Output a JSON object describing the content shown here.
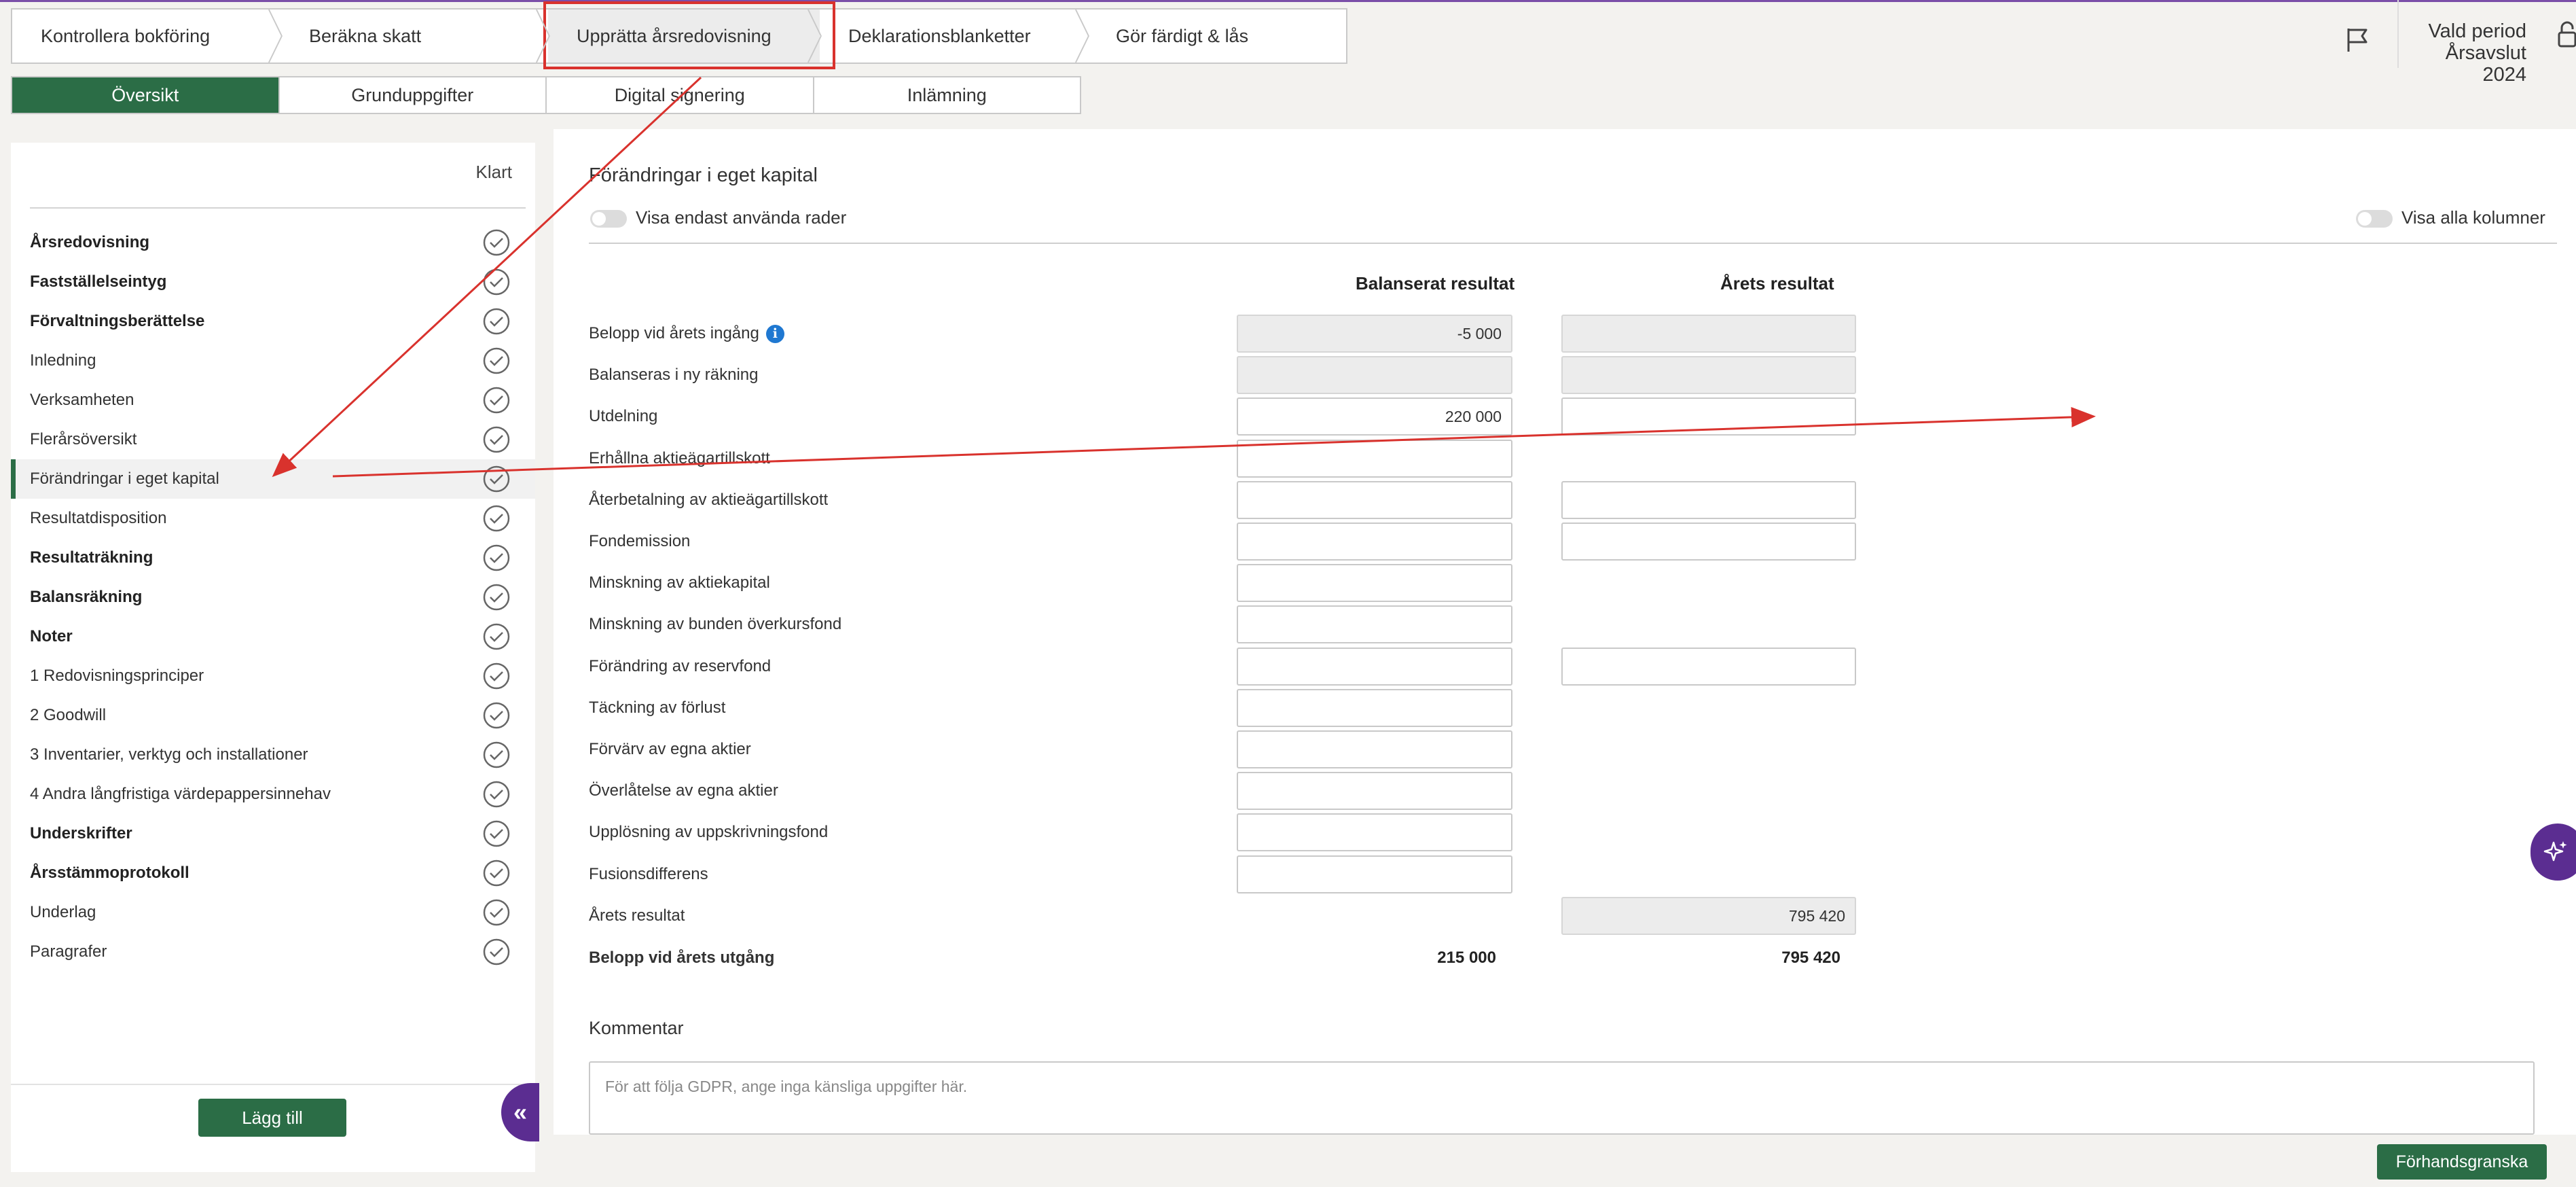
{
  "steps": [
    {
      "label": "Kontrollera bokföring"
    },
    {
      "label": "Beräkna skatt"
    },
    {
      "label": "Upprätta årsredovisning"
    },
    {
      "label": "Deklarationsblanketter"
    },
    {
      "label": "Gör färdigt & lås"
    }
  ],
  "header": {
    "period_label": "Vald period",
    "period_value": "Årsavslut 2024",
    "flag_icon": "flag-icon",
    "lock_icon": "lock-icon"
  },
  "tabs": [
    {
      "label": "Översikt"
    },
    {
      "label": "Grunduppgifter"
    },
    {
      "label": "Digital signering"
    },
    {
      "label": "Inlämning"
    }
  ],
  "sidebar": {
    "header": "Klart",
    "items": [
      {
        "label": "Årsredovisning"
      },
      {
        "label": "Fastställelseintyg"
      },
      {
        "label": "Förvaltningsberättelse"
      },
      {
        "label": "Inledning"
      },
      {
        "label": "Verksamheten"
      },
      {
        "label": "Flerårsöversikt"
      },
      {
        "label": "Förändringar i eget kapital"
      },
      {
        "label": "Resultatdisposition"
      },
      {
        "label": "Resultaträkning"
      },
      {
        "label": "Balansräkning"
      },
      {
        "label": "Noter"
      },
      {
        "label": "1 Redovisningsprinciper"
      },
      {
        "label": "2 Goodwill"
      },
      {
        "label": "3 Inventarier, verktyg och installationer"
      },
      {
        "label": "4 Andra långfristiga värdepappersinnehav"
      },
      {
        "label": "Underskrifter"
      },
      {
        "label": "Årsstämmoprotokoll"
      },
      {
        "label": "Underlag"
      },
      {
        "label": "Paragrafer"
      }
    ],
    "add_button": "Lägg till",
    "collapse_icon": "«"
  },
  "main": {
    "title": "Förändringar i eget kapital",
    "toggle_used_rows": "Visa endast använda rader",
    "toggle_all_columns": "Visa alla kolumner",
    "columns": [
      "Balanserat resultat",
      "Årets resultat"
    ],
    "info_glyph": "i",
    "rows": [
      {
        "label": "Belopp vid årets ingång",
        "c1": "-5 000",
        "c2": ""
      },
      {
        "label": "Balanseras i ny räkning",
        "c1": "",
        "c2": ""
      },
      {
        "label": "Utdelning",
        "c1": "220 000",
        "c2": ""
      },
      {
        "label": "Erhållna aktieägartillskott",
        "c1": ""
      },
      {
        "label": "Återbetalning av aktieägartillskott",
        "c1": "",
        "c2": ""
      },
      {
        "label": "Fondemission",
        "c1": "",
        "c2": ""
      },
      {
        "label": "Minskning av aktiekapital",
        "c1": ""
      },
      {
        "label": "Minskning av bunden överkursfond",
        "c1": ""
      },
      {
        "label": "Förändring av reservfond",
        "c1": "",
        "c2": ""
      },
      {
        "label": "Täckning av förlust",
        "c1": ""
      },
      {
        "label": "Förvärv av egna aktier",
        "c1": ""
      },
      {
        "label": "Överlåtelse av egna aktier",
        "c1": ""
      },
      {
        "label": "Upplösning av uppskrivningsfond",
        "c1": ""
      },
      {
        "label": "Fusionsdifferens",
        "c1": ""
      },
      {
        "label": "Årets resultat",
        "c2": "795 420"
      }
    ],
    "total_label": "Belopp vid årets utgång",
    "total_c1": "215 000",
    "total_c2": "795 420",
    "comment_title": "Kommentar",
    "comment_placeholder": "För att följa GDPR, ange inga känsliga uppgifter här."
  },
  "footer": {
    "preview_button": "Förhandsgranska"
  },
  "colors": {
    "brand_green": "#2b6d46",
    "accent_purple": "#5b2d91",
    "annotation_red": "#d9322d"
  }
}
